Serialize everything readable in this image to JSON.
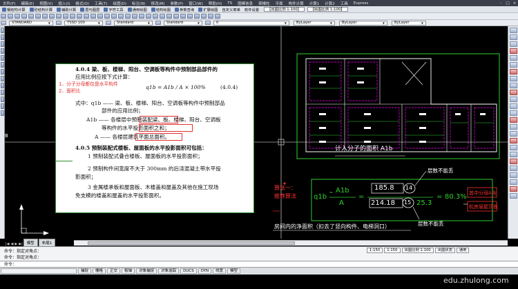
{
  "menubar": {
    "items": [
      "文件(F)",
      "编辑(E)",
      "视图(V)",
      "插入(I)",
      "格式(O)",
      "工具(T)",
      "绘图(D)",
      "标注(N)",
      "修改(M)",
      "参数(P)",
      "窗口(W)",
      "帮助(H)",
      "TS",
      "图模信息",
      "梁楼柱",
      "平面",
      "构件计算",
      "计算1",
      "计算2",
      "工具",
      "Express"
    ],
    "window_controls": [
      "-",
      "□",
      "×"
    ]
  },
  "plugin_toolbar": {
    "items": [
      "钢结构计算",
      "砼结构计算",
      "辅助计算",
      "层与图层",
      "字符工具",
      "通用绘图",
      "结构绘图",
      "参数查询",
      "扩展绘图",
      "自定义菜单",
      "软件设置"
    ],
    "scale_label": "【出图比例 1:100】",
    "scale_label2": "【绘图比例 1:100】"
  },
  "props_toolbar": {
    "text_style": "STANDARD",
    "dim_style": "TSSD 100",
    "table_style": "Standard",
    "mleader_style": "Standard",
    "layer": "0",
    "color": "ByLayer",
    "linetype": "ByLayer",
    "lineweight": "ByLayer"
  },
  "document": {
    "heading": "4.0.4  梁、板、楼梯、阳台、空调板等构件中预制部品部件的",
    "heading2": "应用比例应按下式计算：",
    "note1": "1、分子分母都仅是水平构件",
    "note2": "2、面积比",
    "formula": "q1b = A1b / A × 100%",
    "formula_no": "(4.0.4)",
    "where1": "式中：q1b —— 梁、板、楼梯、阳台、空调板等构件中预制部品",
    "where2": "部件的应用比例；",
    "where3": "A1b —— 各楼层中预制装配梁、板、楼梯、阳台、空调板",
    "where4": "等构件的水平投影面积之和；",
    "where5": "A —— 各楼层建筑平面总面积。",
    "clause405": "4.0.5  预制装配式楼板、屋面板的水平投影面积可包括：",
    "item1": "1  预制装配式叠合楼板、屋面板的水平投影面积；",
    "item2a": "2  预制构件间宽度不大于 300mm 的后浇混凝土带水平投",
    "item2b": "影面积；",
    "item3a": "3  金属楼承板和屋面板、木楼盖和屋盖及其他在施工现场",
    "item3b": "免支模的楼盖和屋盖的水平投影面积。"
  },
  "cad": {
    "plan_caption": "计入分子的面积 A1b",
    "calc_left1": "算法一：",
    "calc_left2": "推荐算法",
    "eq_lhs_num": "A1b",
    "eq_lhs_den": "A",
    "eq_q": "q1b",
    "eq_num": "185.8",
    "eq_num_circ": "14",
    "eq_den": "214.18",
    "eq_den_circ": "15",
    "eq_den_tail": "25.3",
    "eq_result": "80.3%",
    "note_top": "层数不能丢",
    "note_bottom": "层数不能丢",
    "note_right1": "其中分母A含",
    "note_right2": "机房层屋顶板",
    "bottom_text": "房间内的净面积（扣去了竖向构件、电梯洞口）",
    "panel_label": "B"
  },
  "tabs": [
    "模型",
    "布局1"
  ],
  "command": {
    "line1": "命令：指定对角点：",
    "line2": "命令：指定对角点：",
    "prompt": "命令："
  },
  "status_combos": {
    "scale1": "1:150",
    "scale2": "1:150",
    "anno": "出图比例 1:100",
    "state": "出图状态",
    "mode": "通用"
  },
  "statusbar": {
    "coords": "",
    "items": [
      "捕捉",
      "栅格",
      "正交",
      "极轴",
      "对象捕捉",
      "对象追踪",
      "DUCS",
      "DYN",
      "线宽",
      "模型"
    ]
  },
  "watermark": "edu.zhulong.com",
  "colors": {
    "cad_green": "#2fd12f",
    "cad_red": "#ff3030",
    "cad_white": "#ffffff",
    "cad_magenta": "#ff00ff",
    "cad_cyan": "#19d4e0",
    "doc_red": "#e03030"
  }
}
